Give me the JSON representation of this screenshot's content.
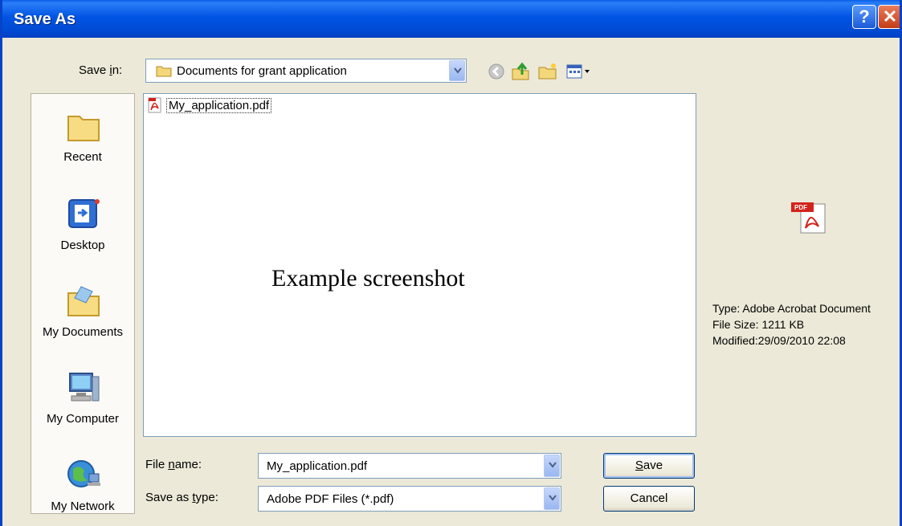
{
  "window": {
    "title": "Save As",
    "help_glyph": "?",
    "close_glyph": "✕"
  },
  "toolbar": {
    "save_in_label_pre": "Save ",
    "save_in_label_key": "i",
    "save_in_label_post": "n:",
    "save_in_value": "Documents for grant application",
    "icons": [
      "back-icon",
      "up-folder-icon",
      "new-folder-icon",
      "views-menu-icon"
    ]
  },
  "places": [
    {
      "label": "Recent",
      "icon": "recent-folder-icon"
    },
    {
      "label": "Desktop",
      "icon": "desktop-icon"
    },
    {
      "label": "My Documents",
      "icon": "my-documents-icon"
    },
    {
      "label": "My Computer",
      "icon": "my-computer-icon"
    },
    {
      "label": "My Network",
      "icon": "my-network-icon"
    }
  ],
  "files": [
    {
      "name": "My_application.pdf",
      "icon": "pdf-file-icon"
    }
  ],
  "overlay_text": "Example screenshot",
  "filename": {
    "label_pre": "File ",
    "label_key": "n",
    "label_post": "ame:",
    "value": "My_application.pdf"
  },
  "filetype": {
    "label_pre": "Save as ",
    "label_key": "t",
    "label_post": "ype:",
    "value": "Adobe PDF Files (*.pdf)"
  },
  "buttons": {
    "save_key": "S",
    "save_rest": "ave",
    "cancel": "Cancel"
  },
  "info": {
    "type": "Type: Adobe Acrobat Document",
    "size": "File Size: 1211 KB",
    "modified": "Modified:29/09/2010 22:08"
  },
  "colors": {
    "titlebar": "#0054e3",
    "dialog_bg": "#ece9d8",
    "border": "#7f9db9"
  }
}
